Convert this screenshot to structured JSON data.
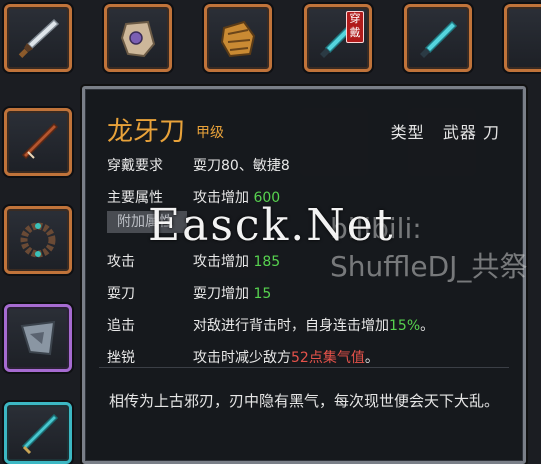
{
  "tooltip": {
    "name": "龙牙刀",
    "grade": "甲级",
    "type_label": "类型",
    "type_value": "武器 刀",
    "requirement": {
      "label": "穿戴要求",
      "value": "耍刀80、敏捷8"
    },
    "main_attribute": {
      "label": "主要属性",
      "text": "攻击增加",
      "value": "600"
    },
    "attached_tab": "附加属性",
    "attack": {
      "label": "攻击",
      "text": "攻击增加",
      "value": "185"
    },
    "blade": {
      "label": "耍刀",
      "text": "耍刀增加",
      "value": "15"
    },
    "chase": {
      "label": "追击",
      "text": "对敌进行背击时，自身连击增加",
      "value": "15%",
      "suffix": "。"
    },
    "frustrate": {
      "label": "挫锐",
      "text": "攻击时减少敌方",
      "value": "52点集气值",
      "suffix": "。"
    },
    "description": "相传为上古邪刃，刃中隐有黑气，每次现世便会天下大乱。"
  },
  "inventory": {
    "equipped_badge": "穿戴",
    "slots": [
      {
        "icon": "sword-icon"
      },
      {
        "icon": "gauntlet-icon"
      },
      {
        "icon": "gold-gauntlet-icon"
      },
      {
        "icon": "cyan-blade-icon"
      },
      {
        "icon": "cyan-blade-icon"
      },
      {
        "icon": "spear-icon"
      },
      {
        "icon": "bead-bracelet-icon"
      },
      {
        "icon": "helmet-icon"
      },
      {
        "icon": "cyan-sword-icon"
      }
    ]
  },
  "watermark": {
    "main": "Easck.Net",
    "sub": "bilibili: ShuffleDJ_共祭"
  },
  "colors": {
    "rare_orange": "#e8a23a",
    "bonus_green": "#57d24f",
    "value_red": "#e5524a"
  }
}
